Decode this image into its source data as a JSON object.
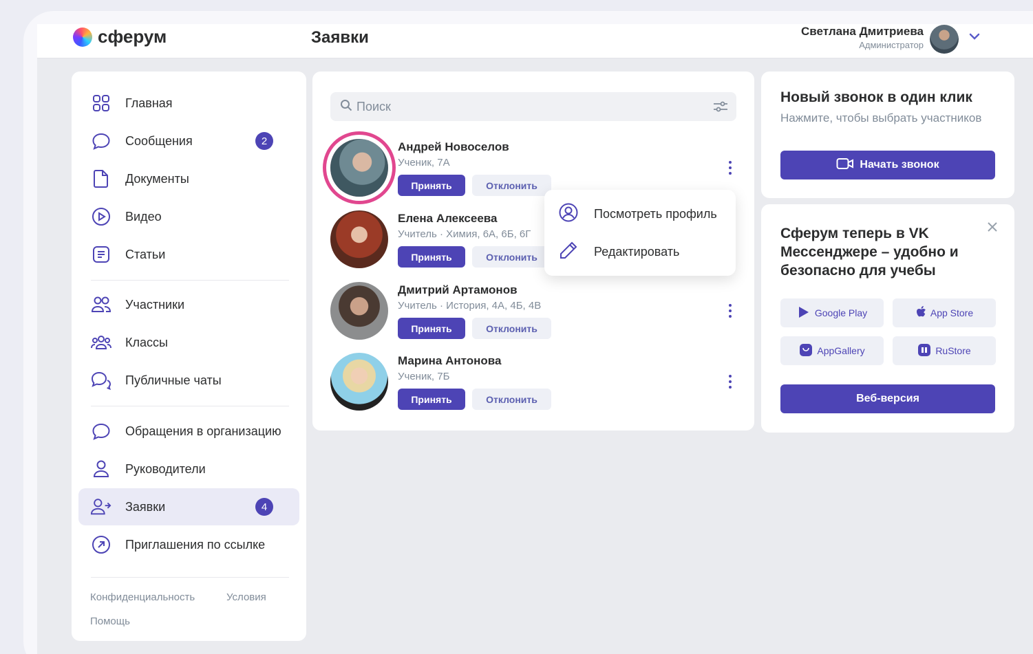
{
  "app": {
    "name": "сферум",
    "page_title": "Заявки"
  },
  "user": {
    "name": "Светлана Дмитриева",
    "role": "Администратор"
  },
  "sidebar": {
    "items": [
      {
        "label": "Главная",
        "icon": "grid-icon"
      },
      {
        "label": "Сообщения",
        "icon": "chat-bubble-icon",
        "badge": "2"
      },
      {
        "label": "Документы",
        "icon": "document-icon"
      },
      {
        "label": "Видео",
        "icon": "play-circle-icon"
      },
      {
        "label": "Статьи",
        "icon": "article-icon"
      },
      {
        "label": "Участники",
        "icon": "people-icon"
      },
      {
        "label": "Классы",
        "icon": "group-icon"
      },
      {
        "label": "Публичные чаты",
        "icon": "public-chat-icon"
      },
      {
        "label": "Обращения в организацию",
        "icon": "chat-bubble-icon"
      },
      {
        "label": "Руководители",
        "icon": "person-icon"
      },
      {
        "label": "Заявки",
        "icon": "person-arrow-icon",
        "badge": "4",
        "active": true
      },
      {
        "label": "Приглашения по ссылке",
        "icon": "link-arrow-icon"
      }
    ],
    "footer": {
      "privacy": "Конфиденциальность",
      "terms": "Условия",
      "help": "Помощь"
    }
  },
  "search": {
    "placeholder": "Поиск"
  },
  "requests": [
    {
      "name": "Андрей Новоселов",
      "subtitle": "Ученик, 7А"
    },
    {
      "name": "Елена Алексеева",
      "subtitle": "Учитель · Химия, 6А, 6Б, 6Г"
    },
    {
      "name": "Дмитрий Артамонов",
      "subtitle": "Учитель · История, 4А, 4Б, 4В"
    },
    {
      "name": "Марина Антонова",
      "subtitle": "Ученик, 7Б"
    }
  ],
  "request_actions": {
    "accept": "Принять",
    "decline": "Отклонить"
  },
  "context_menu": {
    "view_profile": "Посмотреть профиль",
    "edit": "Редактировать"
  },
  "call_card": {
    "title": "Новый звонок в один клик",
    "subtitle": "Нажмите, чтобы выбрать участников",
    "button": "Начать звонок"
  },
  "promo_card": {
    "title": "Сферум теперь в VK Мессенджере – удобно и безопасно для учебы",
    "stores": [
      "Google Play",
      "App Store",
      "AppGallery",
      "RuStore"
    ],
    "web_button": "Веб-версия"
  },
  "colors": {
    "accent": "#4d44b5",
    "highlight_ring": "#e1478f",
    "background": "#eaebef"
  }
}
